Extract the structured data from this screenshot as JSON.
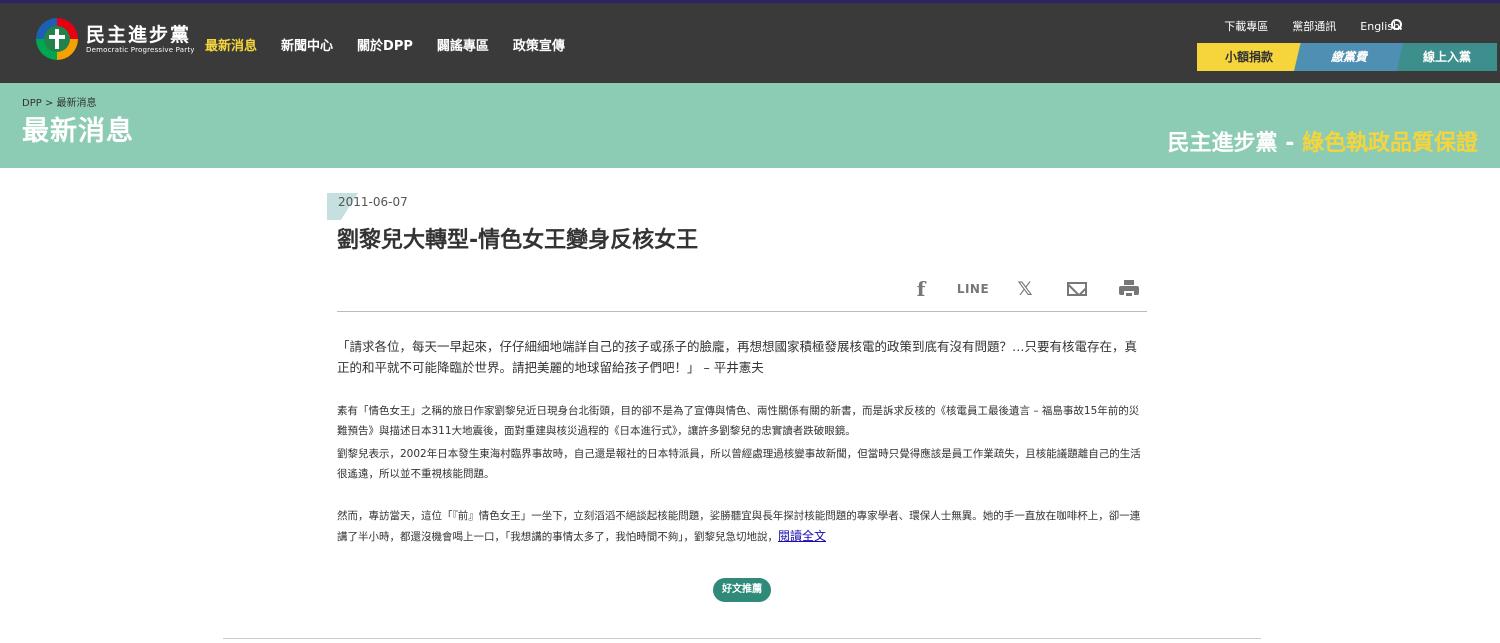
{
  "header": {
    "logo": {
      "cn": "民主進步黨",
      "en": "Democratic Progressive Party"
    },
    "nav": [
      {
        "label": "最新消息",
        "active": true
      },
      {
        "label": "新聞中心",
        "active": false
      },
      {
        "label": "關於DPP",
        "active": false
      },
      {
        "label": "闢謠專區",
        "active": false
      },
      {
        "label": "政策宣傳",
        "active": false
      }
    ],
    "util": {
      "download": "下載專區",
      "directory": "黨部通訊",
      "english": "English"
    },
    "actions": {
      "donate": "小額捐款",
      "fee": "繳黨費",
      "join": "線上入黨"
    },
    "colors": {
      "topbar": "#3a3a3a",
      "active_nav": "#f5d53b",
      "banner": "#8ccbb4"
    }
  },
  "banner": {
    "breadcrumb": "DPP >  最新消息",
    "title": "最新消息",
    "slogan_prefix": "民主進步黨 - ",
    "slogan_highlight": "綠色執政品質保證"
  },
  "article": {
    "date": "2011-06-07",
    "title": "劉黎兒大轉型-情色女王變身反核女王",
    "share": {
      "facebook": "f",
      "line": "LINE",
      "x": "𝕏"
    },
    "quote": "「請求各位，每天一早起來，仔仔細細地端詳自己的孩子或孫子的臉龐，再想想國家積極發展核電的政策到底有沒有問題？…只要有核電存在，真正的和平就不可能降臨於世界。請把美麗的地球留給孩子們吧！」 – 平井憲夫",
    "p1": "素有「情色女王」之稱的旅日作家劉黎兒近日現身台北街頭，目的卻不是為了宣傳與情色、兩性關係有關的新書，而是訴求反核的《核電員工最後遺言 – 福島事故15年前的災難預告》與描述日本311大地震後，面對重建與核災過程的《日本進行式》，讓許多劉黎兒的忠實讀者跌破眼鏡。",
    "p2": "劉黎兒表示，2002年日本發生東海村臨界事故時，自己還是報社的日本特派員，所以曾經處理過核變事故新聞，但當時只覺得應該是員工作業疏失，且核能議題離自己的生活很遙遠，所以並不重視核能問題。",
    "p3": "然而，專訪當天，這位「『前』情色女王」一坐下，立刻滔滔不絕談起核能問題，娑勝聽宜與長年探討核能問題的專家學者、環保人士無異。她的手一直放在咖啡杯上，卻一連講了半小時，都還沒機會喝上一口，「我想講的事情太多了，我怕時間不夠」，劉黎兒急切地說，",
    "read_more": "閱讀全文",
    "recommend": "好文推薦"
  }
}
